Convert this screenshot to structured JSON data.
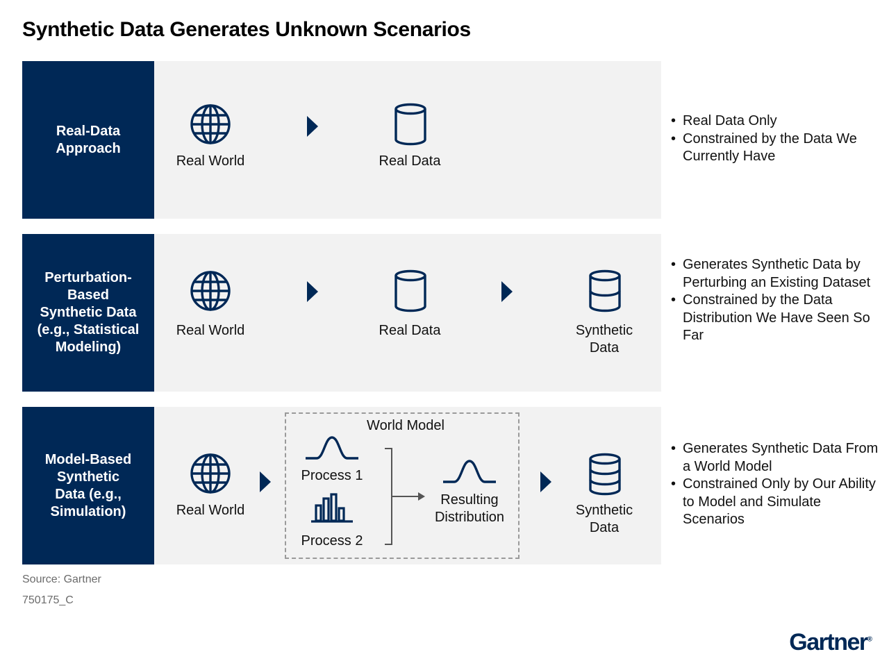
{
  "title": "Synthetic Data Generates Unknown Scenarios",
  "rows": [
    {
      "label": "Real-Data\nApproach",
      "real_world": "Real World",
      "real_data": "Real Data",
      "bullets": [
        "Real Data Only",
        "Constrained by the Data We Currently Have"
      ]
    },
    {
      "label": "Perturbation-\nBased\nSynthetic Data\n(e.g., Statistical\nModeling)",
      "real_world": "Real World",
      "real_data": "Real Data",
      "synthetic": "Synthetic\nData",
      "bullets": [
        "Generates Synthetic Data by Perturbing an Existing Dataset",
        "Constrained by the Data Distribution We Have Seen So Far"
      ]
    },
    {
      "label": "Model-Based\nSynthetic\nData (e.g.,\nSimulation)",
      "real_world": "Real World",
      "world_model": {
        "title": "World Model",
        "process1": "Process 1",
        "process2": "Process 2",
        "resulting": "Resulting\nDistribution"
      },
      "synthetic": "Synthetic\nData",
      "bullets": [
        "Generates Synthetic Data From a World Model",
        "Constrained Only by Our Ability to Model and Simulate Scenarios"
      ]
    }
  ],
  "footer": {
    "source": "Source: Gartner",
    "id": "750175_C"
  },
  "logo": {
    "text": "Gartner",
    "mark": "®"
  },
  "colors": {
    "navy": "#002856",
    "panel": "#f2f2f2",
    "dashed": "#9a9a9a"
  },
  "icons": [
    "globe-icon",
    "cylinder-icon",
    "database-stack-icon",
    "bell-curve-icon",
    "bar-chart-icon",
    "right-arrow-icon"
  ]
}
